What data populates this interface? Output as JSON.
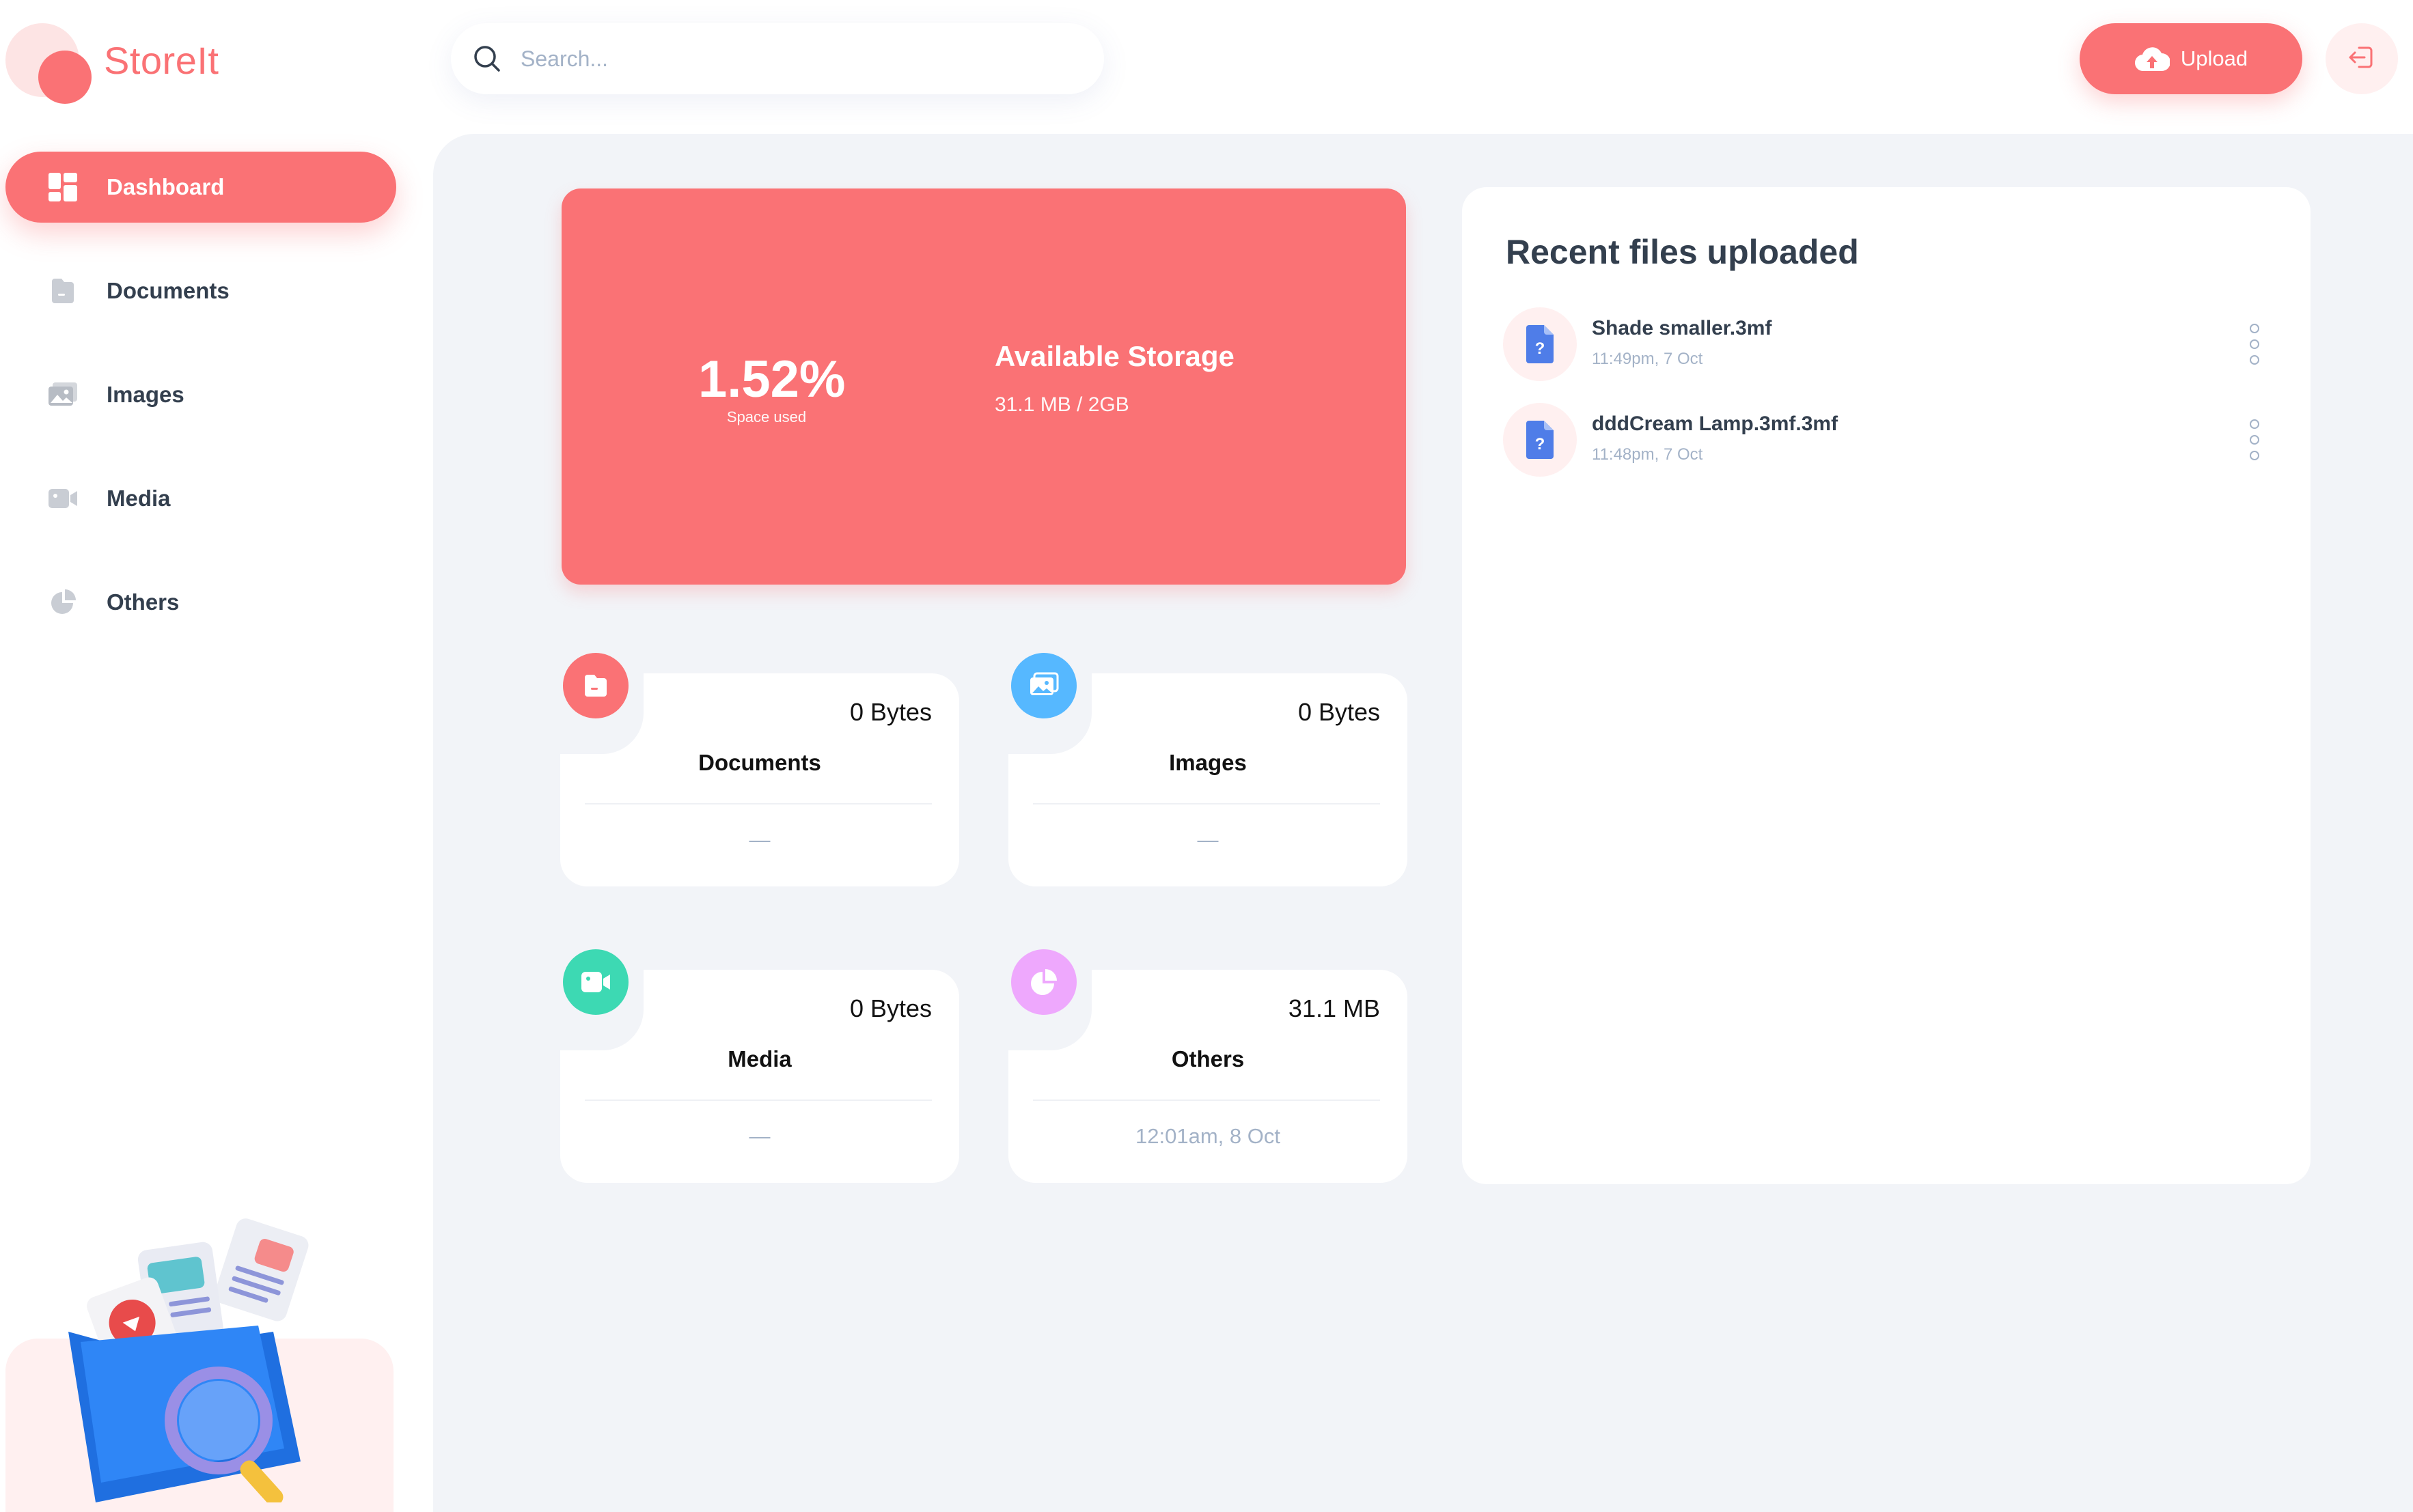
{
  "app": {
    "name": "StoreIt"
  },
  "search": {
    "placeholder": "Search..."
  },
  "header": {
    "upload_label": "Upload"
  },
  "sidebar": {
    "items": [
      {
        "label": "Dashboard",
        "active": true,
        "icon": "dashboard-icon"
      },
      {
        "label": "Documents",
        "active": false,
        "icon": "documents-icon"
      },
      {
        "label": "Images",
        "active": false,
        "icon": "images-icon"
      },
      {
        "label": "Media",
        "active": false,
        "icon": "media-icon"
      },
      {
        "label": "Others",
        "active": false,
        "icon": "others-icon"
      }
    ]
  },
  "storage": {
    "percent": "1.52%",
    "percent_label": "Space used",
    "title": "Available Storage",
    "used": "31.1 MB",
    "separator": "/",
    "total": "2GB",
    "summary": "31.1 MB / 2GB"
  },
  "summary": {
    "documents": {
      "title": "Documents",
      "size": "0 Bytes",
      "date": "—",
      "color": "#fa7275"
    },
    "images": {
      "title": "Images",
      "size": "0 Bytes",
      "date": "—",
      "color": "#56b8ff"
    },
    "media": {
      "title": "Media",
      "size": "0 Bytes",
      "date": "—",
      "color": "#3dd9b3"
    },
    "others": {
      "title": "Others",
      "size": "31.1 MB",
      "date": "12:01am, 8 Oct",
      "color": "#eea8fd"
    }
  },
  "recent": {
    "title": "Recent files uploaded",
    "files": [
      {
        "name": "Shade smaller.3mf",
        "time": "11:49pm, 7 Oct"
      },
      {
        "name": "dddCream Lamp.3mf.3mf",
        "time": "11:48pm, 7 Oct"
      }
    ]
  },
  "colors": {
    "brand": "#fa7275",
    "text": "#333f4e",
    "muted": "#a3b2c7",
    "background": "#f2f4f8"
  }
}
